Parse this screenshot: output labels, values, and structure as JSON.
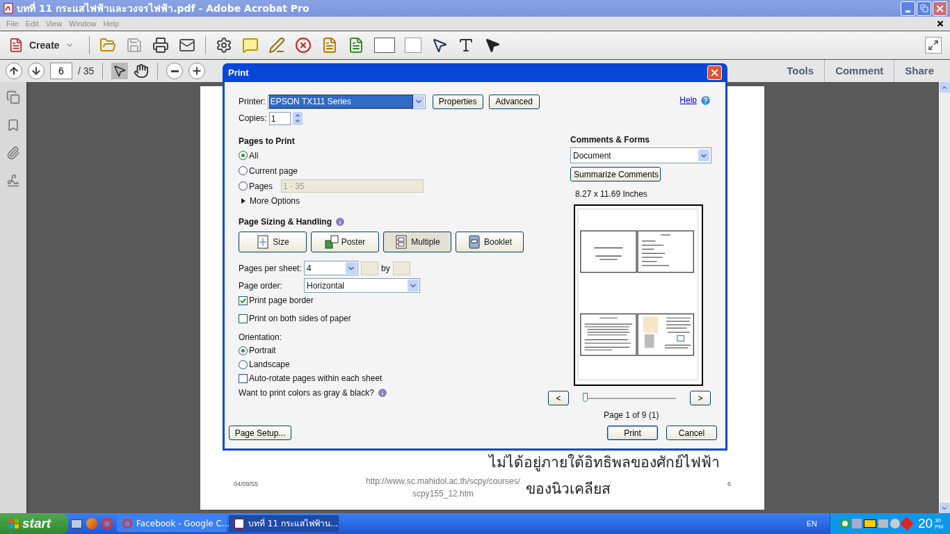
{
  "window": {
    "title": "บทที่ 11 กระแสไฟฟ้าและวงจรไฟฟ้า.pdf - Adobe Acrobat Pro"
  },
  "menu": [
    "File",
    "Edit",
    "View",
    "Window",
    "Help"
  ],
  "toolbar": {
    "create": "Create"
  },
  "navigation": {
    "page": "6",
    "total": "/ 35"
  },
  "panes": [
    {
      "label": "Tools"
    },
    {
      "label": "Comment"
    },
    {
      "label": "Share"
    }
  ],
  "document": {
    "lines": [
      "ไม่ได้อยู่ภายใต้อิทธิพลของศักย์ไฟฟ้า",
      "ของนิวเคลียส"
    ],
    "date": "04/09/55",
    "url": [
      "http://www.sc.mahidol.ac.th/scpy/courses/",
      "scpy155_12.htm"
    ],
    "page_number": "6"
  },
  "dialog": {
    "title": "Print",
    "help": "Help",
    "printer": {
      "label": "Printer:",
      "value": "EPSON TX111 Series"
    },
    "printer_buttons": [
      "Properties",
      "Advanced"
    ],
    "copies": {
      "label": "Copies:",
      "value": "1"
    },
    "pages_to_print": {
      "heading": "Pages to Print",
      "options": [
        {
          "label": "All",
          "selected": true
        },
        {
          "label": "Current page",
          "selected": false
        },
        {
          "label": "Pages",
          "selected": false,
          "range": "1 - 35"
        }
      ],
      "more_options": {
        "label": "More Options",
        "expanded": false
      }
    },
    "sizing": {
      "heading": "Page Sizing & Handling",
      "modes": [
        {
          "label": "Size",
          "kind": "size",
          "selected": false
        },
        {
          "label": "Poster",
          "kind": "poster",
          "selected": false
        },
        {
          "label": "Multiple",
          "kind": "multiple",
          "selected": true
        },
        {
          "label": "Booklet",
          "kind": "booklet",
          "selected": false
        }
      ],
      "pages_per_sheet": {
        "label": "Pages per sheet:",
        "value": "4",
        "by": "by"
      },
      "page_order": {
        "label": "Page order:",
        "value": "Horizontal"
      },
      "checkboxes": [
        {
          "label": "Print page border",
          "checked": true
        },
        {
          "label": "Print on both sides of paper",
          "checked": false
        }
      ],
      "orientation": {
        "label": "Orientation:",
        "options": [
          {
            "label": "Portrait",
            "selected": true
          },
          {
            "label": "Landscape",
            "selected": false
          }
        ]
      },
      "auto_rotate": {
        "label": "Auto-rotate pages within each sheet",
        "checked": false
      },
      "gray_question": "Want to print colors as gray & black?"
    },
    "comments_forms": {
      "heading": "Comments & Forms",
      "value": "Document",
      "button": "Summarize Comments"
    },
    "preview": {
      "paper_size": "8.27 x 11.69 Inches",
      "prev": "<",
      "next": ">",
      "slider": {
        "level": 0
      },
      "page_label": "Page 1 of 9 (1)"
    },
    "buttons": {
      "page_setup": "Page Setup...",
      "print": "Print",
      "cancel": "Cancel"
    }
  },
  "taskbar": {
    "start": "start",
    "tasks": [
      {
        "label": "Facebook - Google C...",
        "selected": false
      },
      {
        "label": "บทที่ 11 กระแสไฟฟ้าน...",
        "selected": true
      }
    ],
    "language": "EN",
    "clock": {
      "hour": "20",
      "minute": "30",
      "period": "PM"
    }
  }
}
